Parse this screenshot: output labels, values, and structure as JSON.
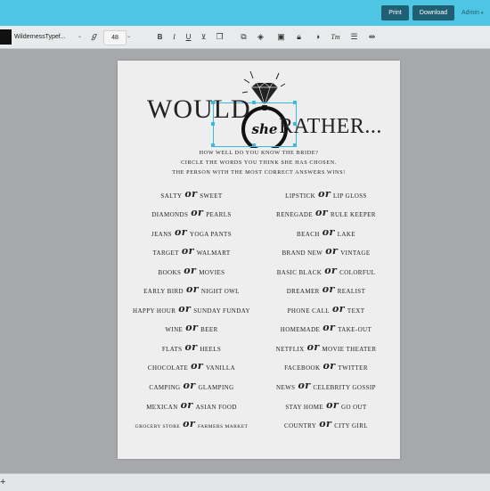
{
  "header": {
    "print_label": "Print",
    "download_label": "Download",
    "admin_label": "Admin"
  },
  "toolbar": {
    "font_name": "WildernessTypef...",
    "font_size": "48",
    "swatch_color": "#111111",
    "icons": [
      "script-style-icon",
      "bold-icon",
      "italic-icon",
      "underline-icon",
      "strikethrough-icon",
      "duplicate-icon",
      "bring-forward-icon",
      "layers-icon",
      "frame-icon",
      "lock-icon",
      "opacity-icon",
      "text-transform-icon",
      "line-spacing-icon",
      "align-icon"
    ]
  },
  "colors": {
    "header_bg": "#4ec6e3",
    "button_bg": "#1e5f73",
    "selection": "#39b9dd"
  },
  "document": {
    "title_would": "WOULD",
    "title_she": "she",
    "title_rather": "RATHER...",
    "intro_lines": [
      "HOW WELL DO YOU KNOW THE BRIDE?",
      "CIRCLE THE WORDS YOU THINK SHE HAS CHOSEN.",
      "THE PERSON WITH THE MOST CORRECT ANSWERS WINS!"
    ],
    "or_word": "or",
    "left_column": [
      {
        "a": "SALTY",
        "b": "SWEET"
      },
      {
        "a": "DIAMONDS",
        "b": "PEARLS"
      },
      {
        "a": "JEANS",
        "b": "YOGA PANTS"
      },
      {
        "a": "TARGET",
        "b": "WALMART"
      },
      {
        "a": "BOOKS",
        "b": "MOVIES"
      },
      {
        "a": "EARLY BIRD",
        "b": "NIGHT OWL"
      },
      {
        "a": "HAPPY HOUR",
        "b": "SUNDAY FUNDAY"
      },
      {
        "a": "WINE",
        "b": "BEER"
      },
      {
        "a": "FLATS",
        "b": "HEELS"
      },
      {
        "a": "CHOCOLATE",
        "b": "VANILLA"
      },
      {
        "a": "CAMPING",
        "b": "GLAMPING"
      },
      {
        "a": "MEXICAN",
        "b": "ASIAN FOOD"
      },
      {
        "a": "GROCERY STORE",
        "b": "FARMERS MARKET"
      }
    ],
    "right_column": [
      {
        "a": "LIPSTICK",
        "b": "LIP GLOSS"
      },
      {
        "a": "RENEGADE",
        "b": "RULE KEEPER"
      },
      {
        "a": "BEACH",
        "b": "LAKE"
      },
      {
        "a": "BRAND NEW",
        "b": "VINTAGE"
      },
      {
        "a": "BASIC BLACK",
        "b": "COLORFUL"
      },
      {
        "a": "DREAMER",
        "b": "REALIST"
      },
      {
        "a": "PHONE CALL",
        "b": "TEXT"
      },
      {
        "a": "HOMEMADE",
        "b": "TAKE-OUT"
      },
      {
        "a": "NETFLIX",
        "b": "MOVIE THEATER"
      },
      {
        "a": "FACEBOOK",
        "b": "TWITTER"
      },
      {
        "a": "NEWS",
        "b": "CELEBRITY GOSSIP"
      },
      {
        "a": "STAY HOME",
        "b": "GO OUT"
      },
      {
        "a": "COUNTRY",
        "b": "CITY GIRL"
      }
    ]
  },
  "footer": {
    "add_label": "+"
  }
}
